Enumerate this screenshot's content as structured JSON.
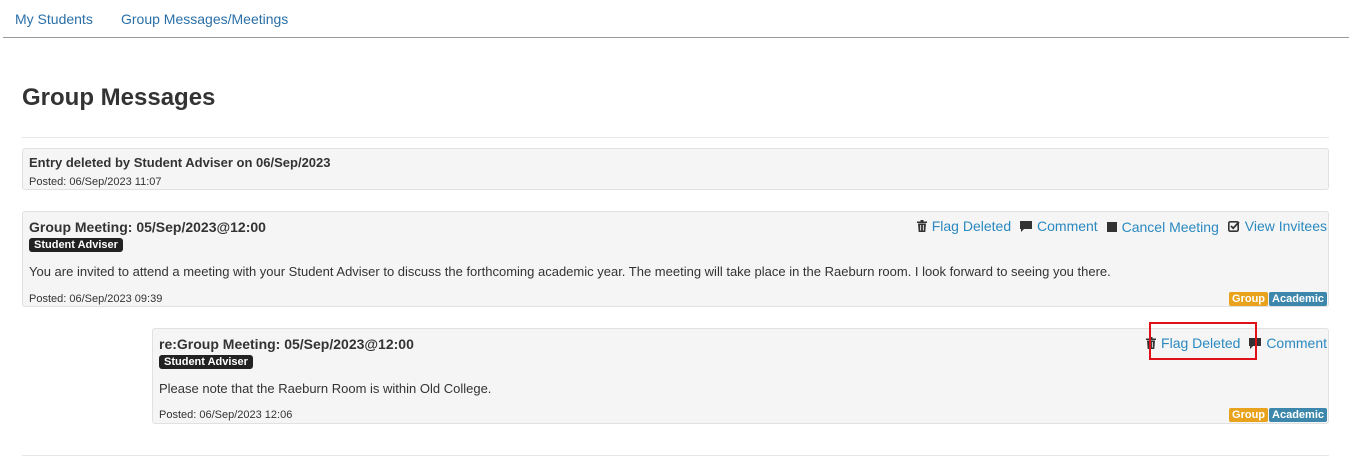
{
  "nav": {
    "tabs": [
      {
        "label": "My Students"
      },
      {
        "label": "Group Messages/Meetings"
      }
    ]
  },
  "page": {
    "title": "Group Messages"
  },
  "deleted_entry": {
    "title": "Entry deleted by Student Adviser on 06/Sep/2023",
    "posted": "Posted: 06/Sep/2023 11:07"
  },
  "meeting": {
    "title": "Group Meeting: 05/Sep/2023@12:00",
    "role": "Student Adviser",
    "body": "You are invited to attend a meeting with your Student Adviser to discuss the forthcoming academic year. The meeting will take place in the Raeburn room. I look forward to seeing you there.",
    "posted": "Posted: 06/Sep/2023 09:39",
    "actions": {
      "flag_deleted": "Flag Deleted",
      "comment": "Comment",
      "cancel_meeting": "Cancel Meeting",
      "view_invitees": "View Invitees"
    },
    "tags": [
      "Group",
      "Academic"
    ]
  },
  "reply": {
    "title": "re:Group Meeting: 05/Sep/2023@12:00",
    "role": "Student Adviser",
    "body": "Please note that the Raeburn Room is within Old College.",
    "posted": "Posted: 06/Sep/2023 12:06",
    "actions": {
      "flag_deleted": "Flag Deleted",
      "comment": "Comment"
    },
    "tags": [
      "Group",
      "Academic"
    ]
  },
  "colors": {
    "link": "#2a89c0",
    "tag_group": "#e8a21c",
    "tag_academic": "#3c87ab",
    "highlight": "#e0101a"
  }
}
